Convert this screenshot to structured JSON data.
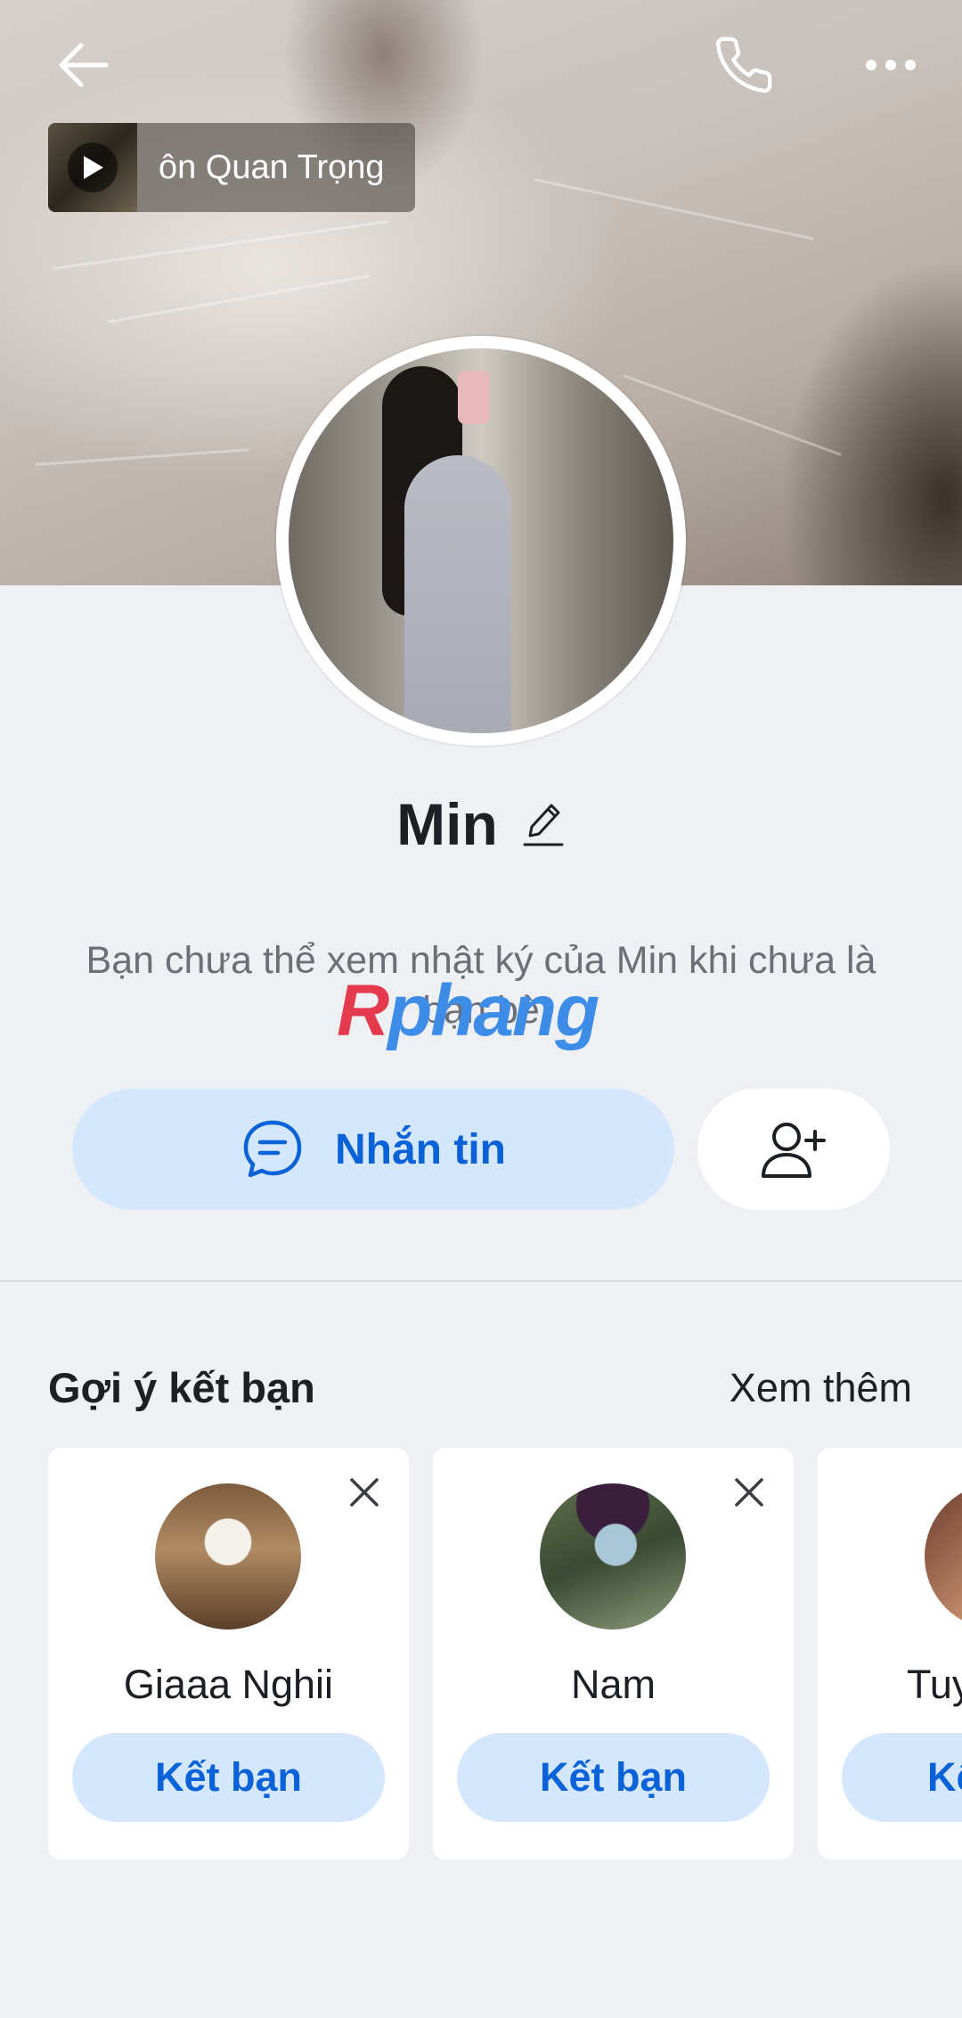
{
  "cover": {
    "music": {
      "title": "ôn Quan Trọng"
    }
  },
  "topbar": {
    "back_icon": "arrow-left-icon",
    "call_icon": "phone-icon",
    "more_icon": "ellipsis-icon"
  },
  "profile": {
    "name": "Min",
    "notice": "Bạn chưa thể xem nhật ký của Min khi chưa là bạn bè",
    "watermark": {
      "part1": "R",
      "part2": "phang"
    }
  },
  "actions": {
    "message_label": "Nhắn tin",
    "message_icon": "chat-bubble-icon",
    "add_friend_icon": "add-user-icon"
  },
  "suggestions": {
    "title": "Gợi ý kết bạn",
    "see_more": "Xem thêm",
    "items": [
      {
        "name": "Giaaa Nghii",
        "button": "Kết bạn"
      },
      {
        "name": "Nam",
        "button": "Kết bạn"
      },
      {
        "name": "Tuy",
        "button": "Kết"
      }
    ]
  },
  "colors": {
    "accent": "#0a62d8",
    "accent_bg": "#d5e7fd",
    "page_bg": "#eff0f4"
  }
}
